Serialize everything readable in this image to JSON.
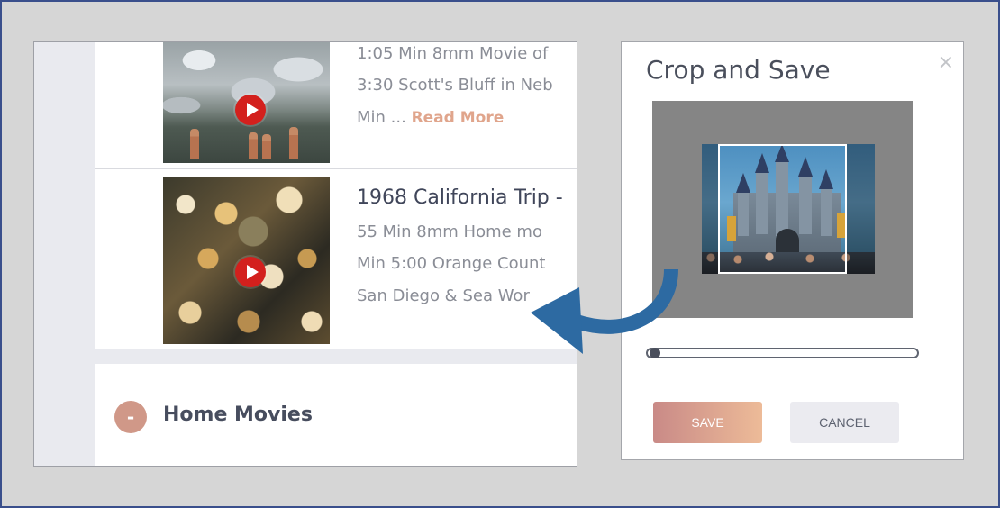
{
  "left_panel": {
    "row1": {
      "line1": "1:05 Min 8mm Movie of",
      "line2": "3:30 Scott's Bluff in Neb",
      "line3_prefix": "Min ... ",
      "read_more": "Read More"
    },
    "row2": {
      "title": "1968 California Trip -",
      "line1": "55 Min 8mm Home mo",
      "line2": "Min 5:00 Orange Count",
      "line3": "San Diego & Sea Wor"
    },
    "section": {
      "toggle": "-",
      "title": "Home Movies"
    }
  },
  "dialog": {
    "title": "Crop and Save",
    "close": "×",
    "zoom_level": 0,
    "save_label": "SAVE",
    "cancel_label": "CANCEL"
  },
  "colors": {
    "accent_save_start": "#c98a87",
    "accent_save_end": "#edbb98",
    "read_more": "#e0a58c",
    "play_button": "#d3201d",
    "arrow": "#2d6aa2"
  },
  "icons": {
    "play": "play-icon",
    "close": "close-icon",
    "arrow": "curved-arrow-icon"
  }
}
